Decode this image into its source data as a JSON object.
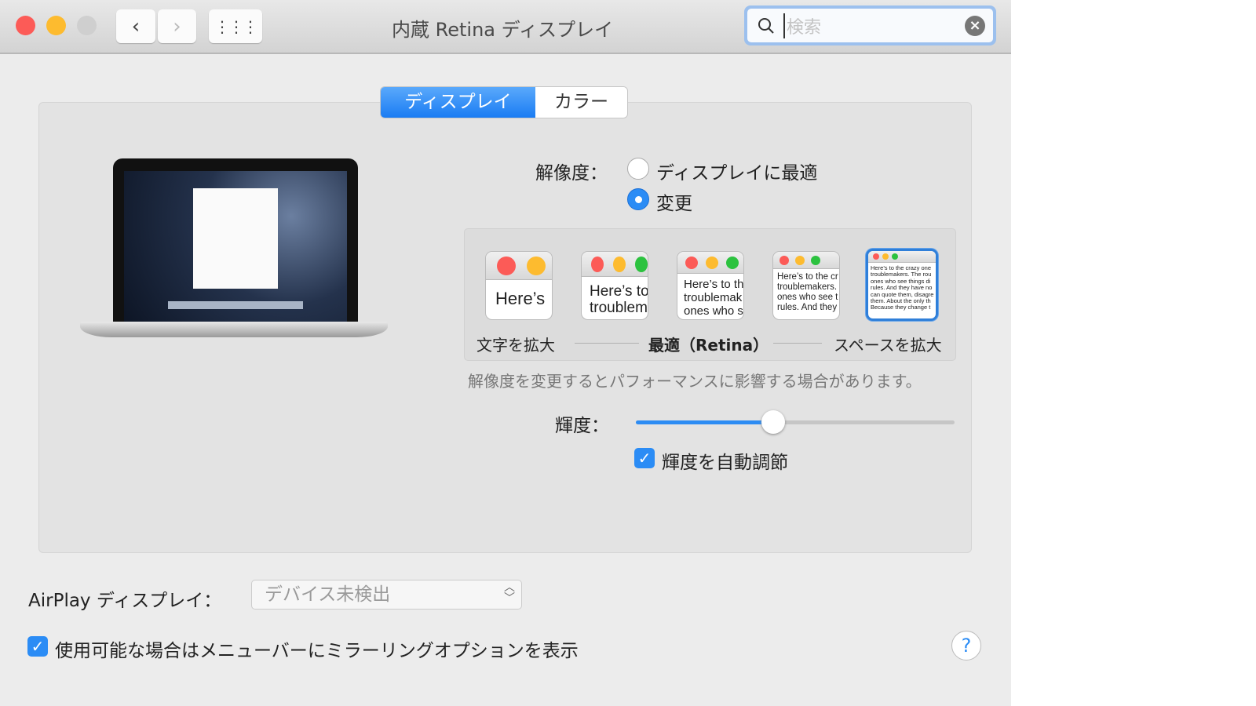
{
  "window": {
    "title": "内蔵 Retina ディスプレイ",
    "search_placeholder": "検索"
  },
  "tabs": [
    {
      "label": "ディスプレイ",
      "selected": true
    },
    {
      "label": "カラー",
      "selected": false
    }
  ],
  "resolution": {
    "label": "解像度：",
    "options": [
      {
        "label": "ディスプレイに最適",
        "selected": false
      },
      {
        "label": "変更",
        "selected": true
      }
    ]
  },
  "scaling": {
    "thumbs": [
      "Here’s",
      "Here’s to\ntroublem",
      "Here’s to th\ntroublemak\nones who s",
      "Here’s to the cr\ntroublemakers.\nones who see t\nrules. And they",
      "Here’s to the crazy one\ntroublemakers. The rou\nones who see things di\nrules. And they have no\ncan quote them, disagre\nthem. About the only th\nBecause they change t"
    ],
    "selected_index": 4,
    "left_label": "文字を拡大",
    "center_label": "最適（Retina）",
    "right_label": "スペースを拡大"
  },
  "note": "解像度を変更するとパフォーマンスに影響する場合があります。",
  "brightness": {
    "label": "輝度：",
    "value": 0.43,
    "auto_label": "輝度を自動調節",
    "auto_checked": true
  },
  "airplay": {
    "label": "AirPlay ディスプレイ：",
    "value": "デバイス未検出"
  },
  "mirroring": {
    "label": "使用可能な場合はメニューバーにミラーリングオプションを表示",
    "checked": true
  },
  "help": "?",
  "colors": {
    "accent": "#2b8cf5",
    "close": "#fc5b57",
    "minimize": "#fdbb2f",
    "zoom_disabled": "#cfcfcf"
  }
}
